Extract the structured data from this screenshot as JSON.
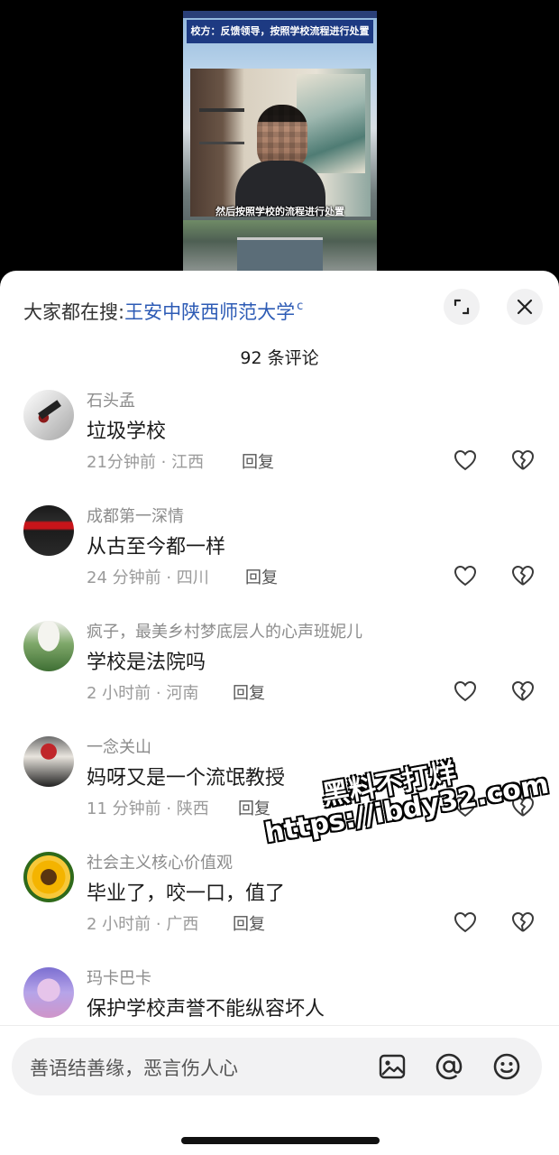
{
  "video": {
    "top_caption": "校方：反馈领导，按照学校流程进行处置",
    "subtitle": "然后按照学校的流程进行处置"
  },
  "search_hint": {
    "prefix": "大家都在搜:",
    "term": "王安中陕西师范大学",
    "icon": "search-icon"
  },
  "header": {
    "expand_icon": "expand-icon",
    "close_icon": "close-icon",
    "comment_count_title": "92 条评论"
  },
  "comments": [
    {
      "user": "石头孟",
      "text": "垃圾学校",
      "meta": "21分钟前 · 江西",
      "reply_label": "回复"
    },
    {
      "user": "成都第一深情",
      "text": "从古至今都一样",
      "meta": "24 分钟前 · 四川",
      "reply_label": "回复"
    },
    {
      "user": "疯子，最美乡村梦底层人的心声班妮儿",
      "text": "学校是法院吗",
      "meta": "2 小时前 · 河南",
      "reply_label": "回复"
    },
    {
      "user": "一念关山",
      "text": "妈呀又是一个流氓教授",
      "meta": "11 分钟前 · 陕西",
      "reply_label": "回复"
    },
    {
      "user": "社会主义核心价值观",
      "text": "毕业了，咬一口，值了",
      "meta": "2 小时前 · 广西",
      "reply_label": "回复"
    },
    {
      "user": "玛卡巴卡",
      "text": "保护学校声誉不能纵容坏人",
      "meta": "",
      "reply_label": ""
    }
  ],
  "watermark": {
    "line1": "黑料不打烊",
    "line2": "https://ibdy32.com"
  },
  "input_bar": {
    "placeholder": "善语结善缘，恶言伤人心",
    "icons": [
      "image-icon",
      "at-icon",
      "emoji-icon"
    ]
  },
  "colors": {
    "link_blue": "#2d5bb5",
    "sheet_bg": "#ffffff",
    "muted_text": "#8c8c8c"
  }
}
